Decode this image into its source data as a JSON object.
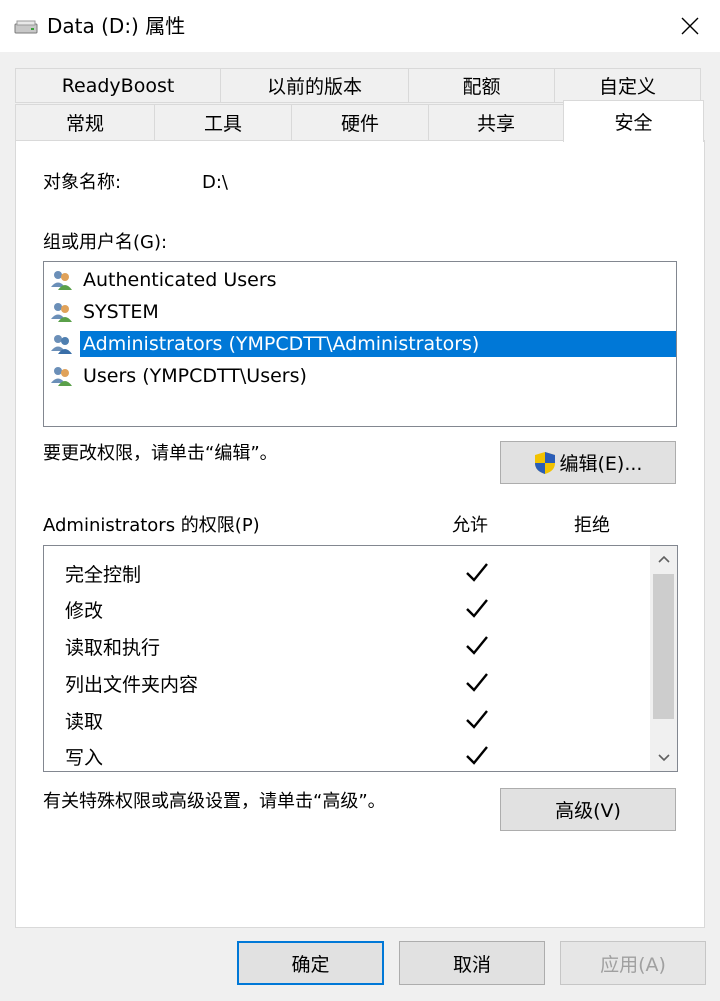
{
  "window": {
    "title": "Data (D:) 属性",
    "close_label": "×"
  },
  "tabs_row1": [
    "ReadyBoost",
    "以前的版本",
    "配额",
    "自定义"
  ],
  "tabs_row2": [
    "常规",
    "工具",
    "硬件",
    "共享",
    "安全"
  ],
  "object": {
    "label": "对象名称:",
    "value": "D:\\"
  },
  "groups": {
    "label": "组或用户名(G):",
    "items": [
      "Authenticated Users",
      "SYSTEM",
      "Administrators (YMPCDTT\\Administrators)",
      "Users (YMPCDTT\\Users)"
    ],
    "selected_index": 2
  },
  "edit": {
    "hint": "要更改权限，请单击“编辑”。",
    "button_label": "编辑(E)..."
  },
  "permissions": {
    "header": "Administrators 的权限(P)",
    "allow_header": "允许",
    "deny_header": "拒绝",
    "items": [
      "完全控制",
      "修改",
      "读取和执行",
      "列出文件夹内容",
      "读取",
      "写入"
    ],
    "allow": [
      true,
      true,
      true,
      true,
      true,
      true
    ],
    "deny": [
      false,
      false,
      false,
      false,
      false,
      false
    ]
  },
  "advanced": {
    "hint": "有关特殊权限或高级设置，请单击“高级”。",
    "button_label": "高级(V)"
  },
  "footer": {
    "ok": "确定",
    "cancel": "取消",
    "apply": "应用(A)"
  },
  "colors": {
    "selection": "#0078d7",
    "accent_border": "#0078d7",
    "disabled_text": "#a0a0a0"
  }
}
